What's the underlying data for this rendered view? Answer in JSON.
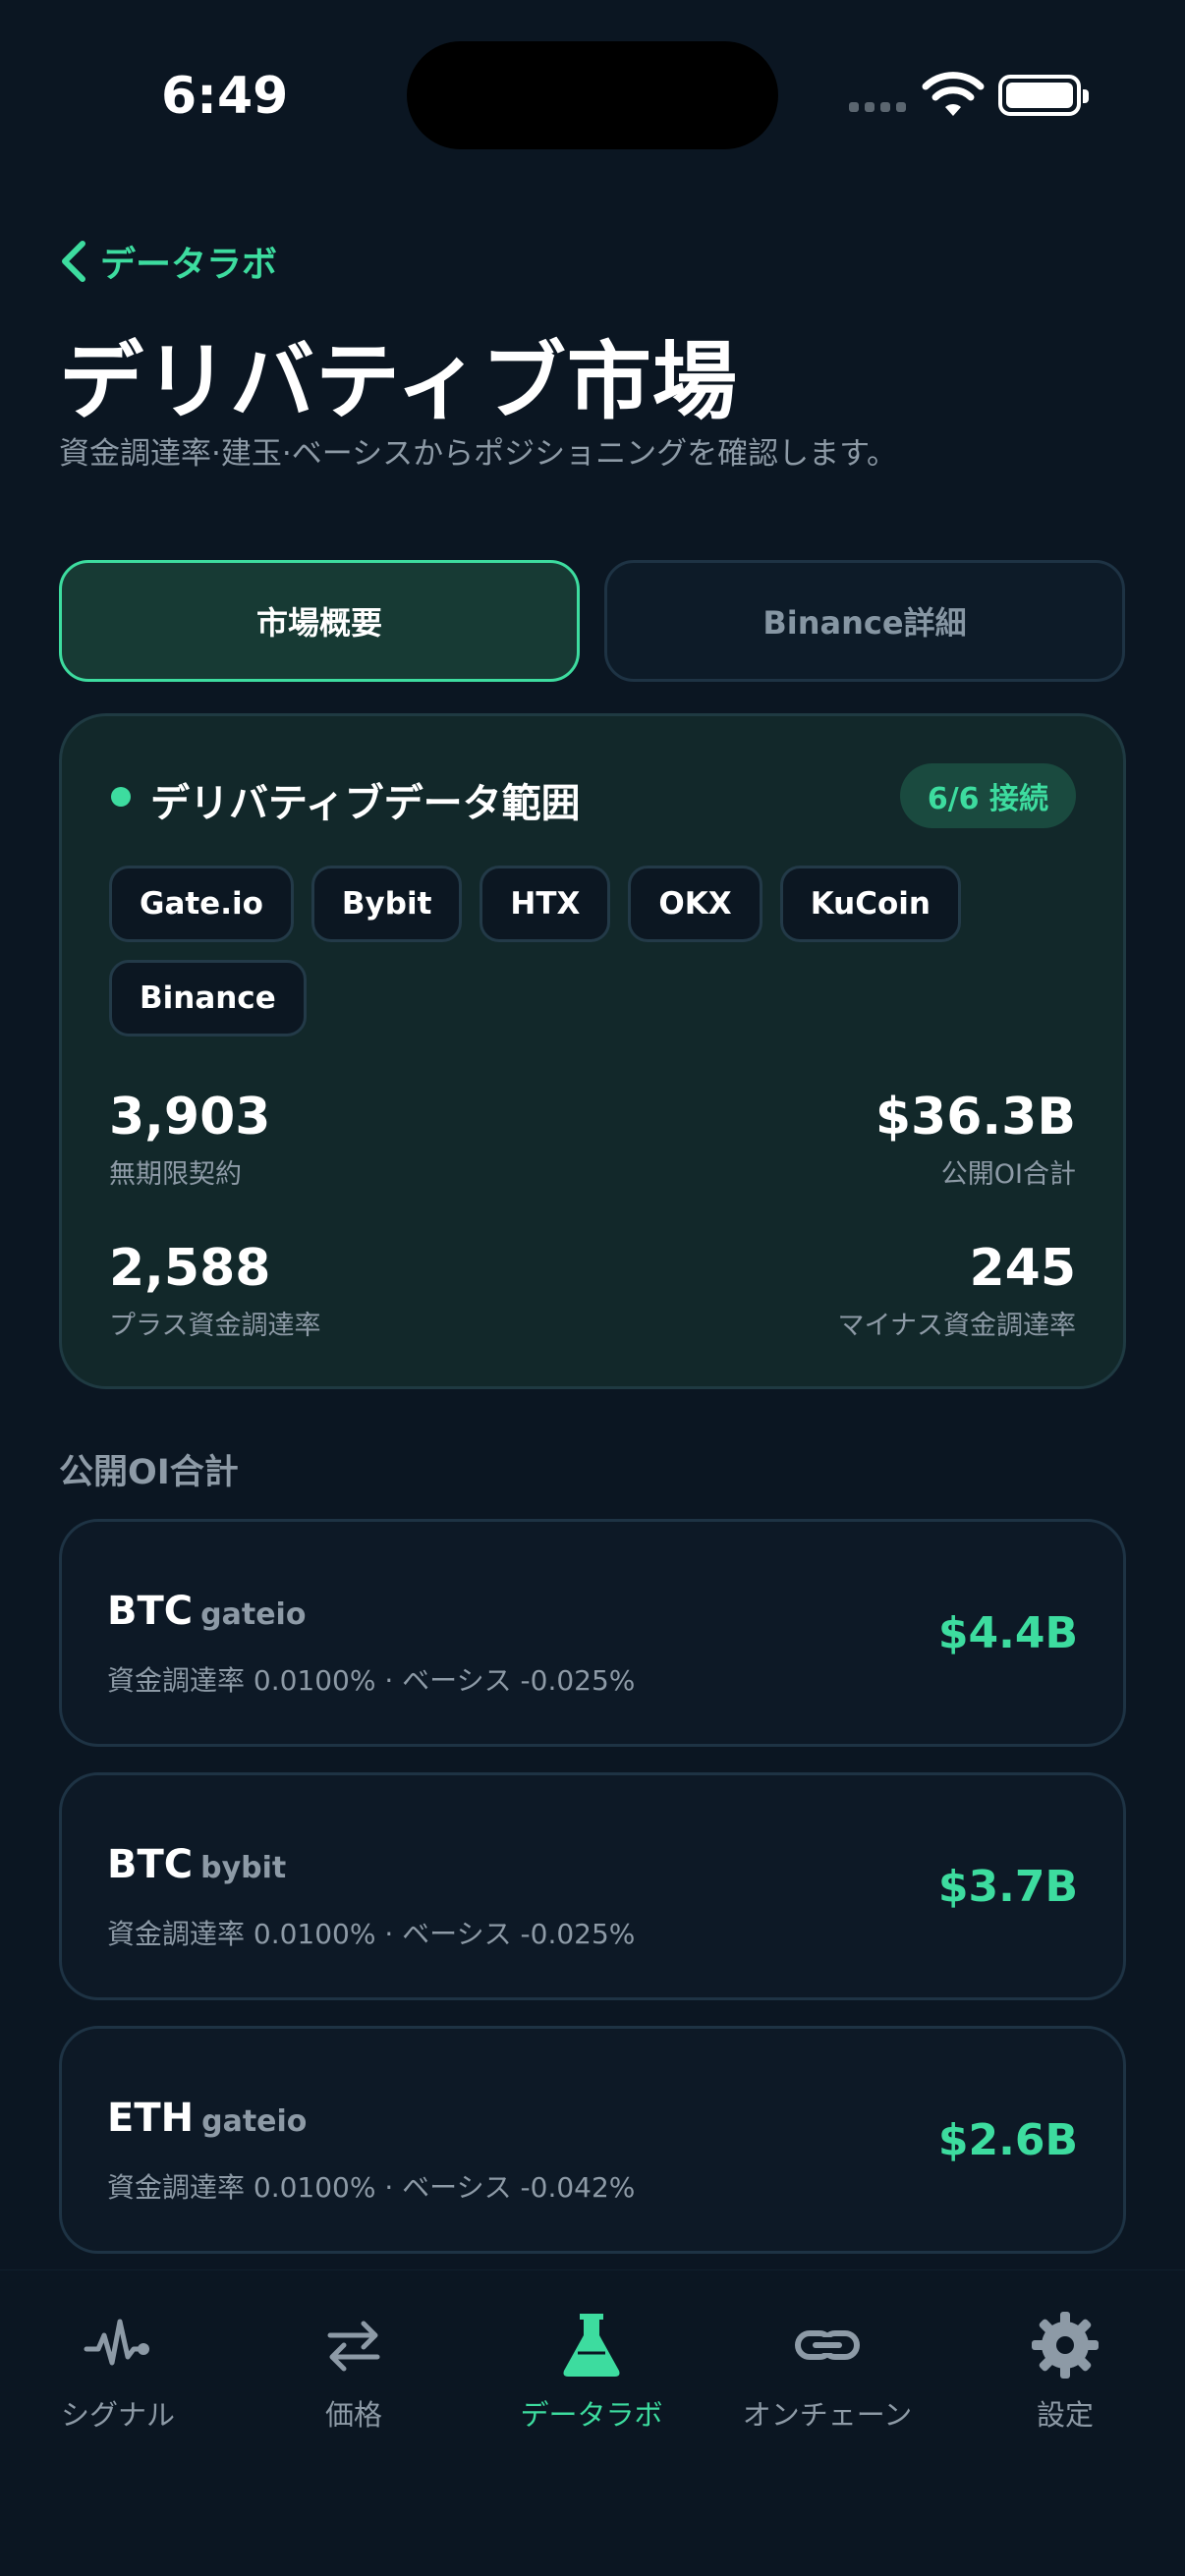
{
  "status_bar": {
    "time": "6:49"
  },
  "header": {
    "back_label": "データラボ",
    "title": "デリバティブ市場",
    "subtitle": "資金調達率·建玉·ベーシスからポジショニングを確認します。"
  },
  "segments": [
    {
      "label": "市場概要",
      "selected": true
    },
    {
      "label": "Binance詳細",
      "selected": false
    }
  ],
  "scope": {
    "title": "デリバティブデータ範囲",
    "badge": "6/6 接続",
    "exchanges": [
      "Gate.io",
      "Bybit",
      "HTX",
      "OKX",
      "KuCoin",
      "Binance"
    ],
    "stats": {
      "perpetuals": {
        "value": "3,903",
        "label": "無期限契約"
      },
      "open_interest": {
        "value": "$36.3B",
        "label": "公開OI合計"
      },
      "positive_funding": {
        "value": "2,588",
        "label": "プラス資金調達率"
      },
      "negative_funding": {
        "value": "245",
        "label": "マイナス資金調達率"
      }
    }
  },
  "oi_section": {
    "title": "公開OI合計",
    "items": [
      {
        "symbol": "BTC",
        "exchange": "gateio",
        "meta": "資金調達率 0.0100% · ベーシス -0.025%",
        "value": "$4.4B"
      },
      {
        "symbol": "BTC",
        "exchange": "bybit",
        "meta": "資金調達率 0.0100% · ベーシス -0.025%",
        "value": "$3.7B"
      },
      {
        "symbol": "ETH",
        "exchange": "gateio",
        "meta": "資金調達率 0.0100% · ベーシス -0.042%",
        "value": "$2.6B"
      }
    ]
  },
  "tabbar": [
    {
      "label": "シグナル",
      "icon": "waveform-icon",
      "active": false
    },
    {
      "label": "価格",
      "icon": "arrows-exchange-icon",
      "active": false
    },
    {
      "label": "データラボ",
      "icon": "flask-icon",
      "active": true
    },
    {
      "label": "オンチェーン",
      "icon": "link-icon",
      "active": false
    },
    {
      "label": "設定",
      "icon": "gear-icon",
      "active": false
    }
  ],
  "colors": {
    "accent": "#3ddc9f",
    "background": "#0b1622",
    "muted": "#8d9aa6"
  }
}
